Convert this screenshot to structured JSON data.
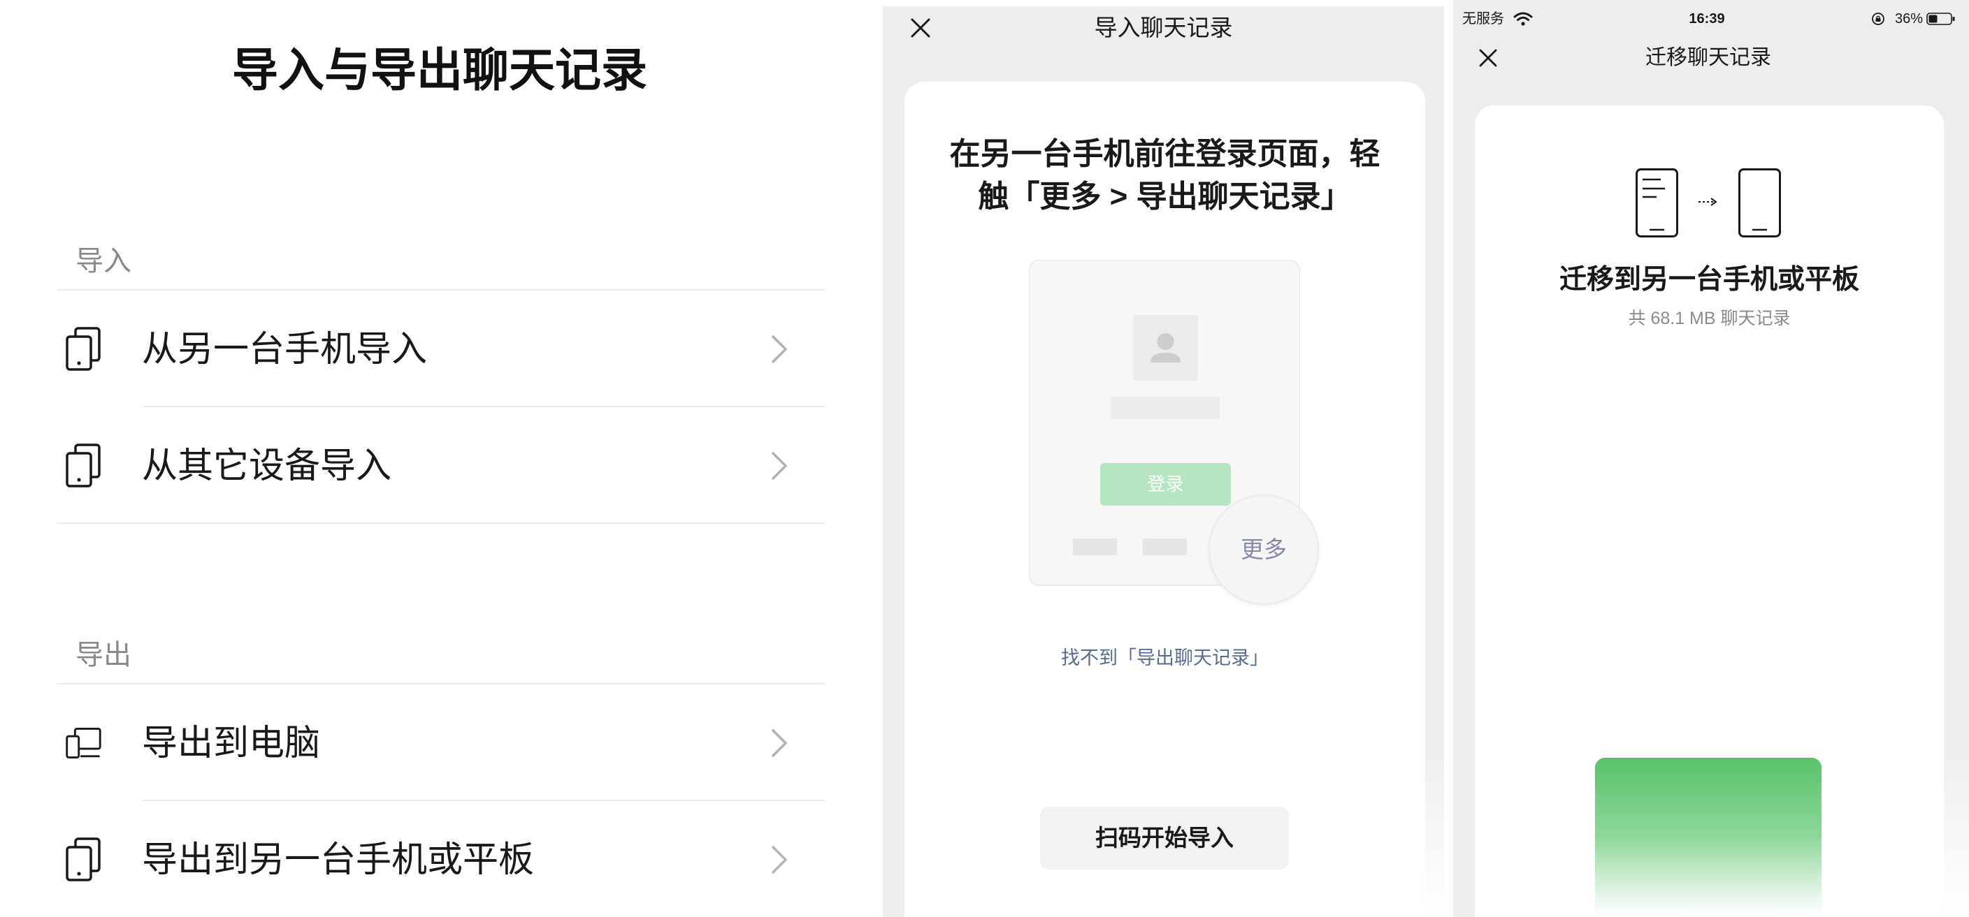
{
  "panel_export": {
    "title": "导入与导出聊天记录",
    "sections": [
      {
        "header": "导入",
        "items": [
          {
            "label": "从另一台手机导入",
            "icon": "phone-icon"
          },
          {
            "label": "从其它设备导入",
            "icon": "phone-icon"
          }
        ]
      },
      {
        "header": "导出",
        "items": [
          {
            "label": "导出到电脑",
            "icon": "computer-icon"
          },
          {
            "label": "导出到另一台手机或平板",
            "icon": "phone-icon"
          }
        ]
      }
    ],
    "chevron_icon": "chevron-right-icon"
  },
  "panel_import": {
    "close_icon": "close-icon",
    "nav_title": "导入聊天记录",
    "instruction_line1": "在另一台手机前往登录页面，轻",
    "instruction_line2": "触「更多 > 导出聊天记录」",
    "mock_login_label": "登录",
    "mock_more_label": "更多",
    "help_link": "找不到「导出聊天记录」",
    "scan_button": "扫码开始导入"
  },
  "panel_migrate": {
    "status": {
      "carrier": "无服务",
      "time": "16:39",
      "battery": "36%",
      "icons": [
        "wifi-icon",
        "orientation-lock-icon",
        "battery-icon"
      ]
    },
    "close_icon": "close-icon",
    "nav_title": "迁移聊天记录",
    "heading": "迁移到另一台手机或平板",
    "subtitle": "共 68.1 MB 聊天记录"
  },
  "colors": {
    "accent_green": "#57c369",
    "link": "#576b95",
    "page_background": "#ededed",
    "text": "#191919",
    "secondary_text": "#8a8a8a"
  }
}
